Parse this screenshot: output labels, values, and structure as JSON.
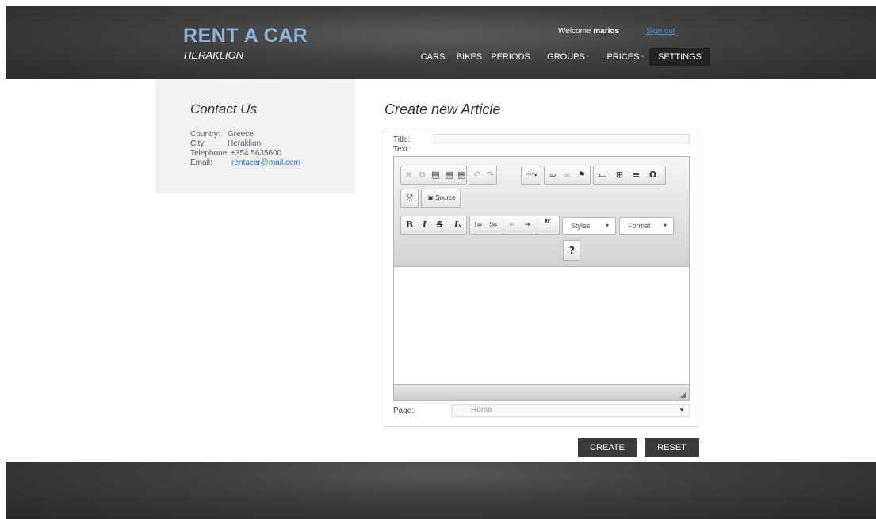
{
  "brand": {
    "title": "RENT A CAR",
    "subtitle": "HERAKLION"
  },
  "user": {
    "welcome_prefix": "Welcome",
    "username": "marios",
    "signout_label": "Sign out"
  },
  "nav": {
    "items": [
      {
        "label": "CARS"
      },
      {
        "label": "BIKES"
      },
      {
        "label": "PERIODS"
      },
      {
        "label": "GROUPS"
      },
      {
        "label": "PRICES"
      },
      {
        "label": "SETTINGS"
      }
    ],
    "active": "SETTINGS"
  },
  "contact": {
    "heading": "Contact Us",
    "rows": [
      {
        "label": "Country:",
        "value": "Greece"
      },
      {
        "label": "City:",
        "value": "Heraklion"
      },
      {
        "label": "Telephone:",
        "value": "+354 5635600"
      },
      {
        "label": "Email:",
        "value": "rentacar@mail.com"
      }
    ]
  },
  "main": {
    "heading": "Create new Article",
    "title_label": "Title:",
    "title_value": "",
    "text_label": "Text:",
    "page_label": "Page:",
    "page_value": "Home"
  },
  "editor": {
    "source_label": "Source",
    "styles_label": "Styles",
    "format_label": "Format",
    "help_label": "?",
    "icons": [
      "cut-icon",
      "copy-icon",
      "paste-icon",
      "paste-text-icon",
      "paste-word-icon",
      "undo-icon",
      "redo-icon",
      "spellcheck-icon",
      "link-icon",
      "unlink-icon",
      "anchor-icon",
      "image-icon",
      "table-icon",
      "horizontal-rule-icon",
      "special-char-icon",
      "maximize-icon",
      "bold-icon",
      "italic-icon",
      "strike-icon",
      "remove-format-icon",
      "numbered-list-icon",
      "bulleted-list-icon",
      "outdent-icon",
      "indent-icon",
      "blockquote-icon"
    ]
  },
  "actions": {
    "create_label": "CREATE",
    "reset_label": "RESET"
  }
}
